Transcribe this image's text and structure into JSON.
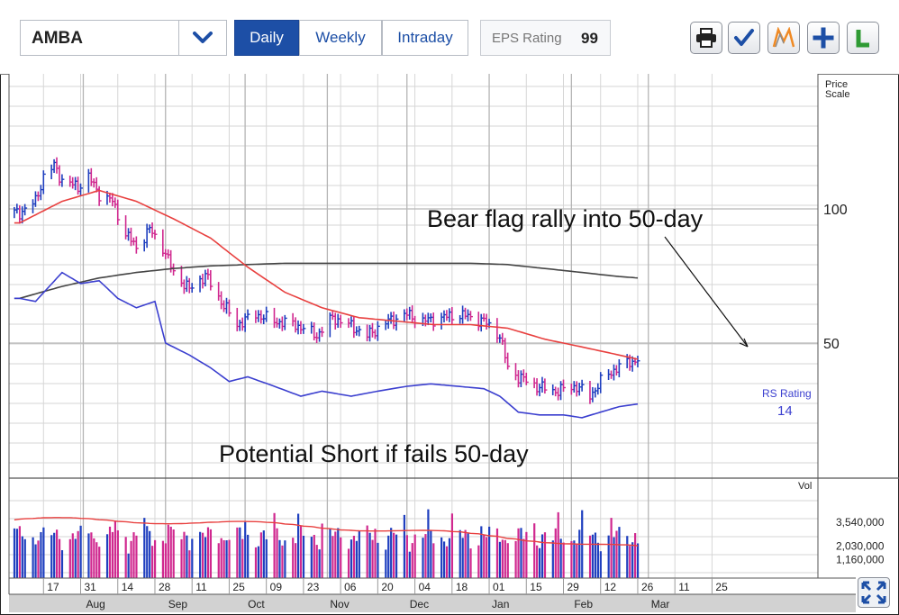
{
  "toolbar": {
    "symbol": "AMBA",
    "tabs": [
      {
        "label": "Daily",
        "active": true
      },
      {
        "label": "Weekly",
        "active": false
      },
      {
        "label": "Intraday",
        "active": false
      }
    ],
    "eps_label": "EPS Rating",
    "eps_value": "99",
    "tools": [
      "print-icon",
      "checkmark-icon",
      "marketsmith-logo-icon",
      "plus-icon",
      "leaderboard-l-icon"
    ]
  },
  "colors": {
    "up_bar": "#1f3fbf",
    "down_bar": "#d0288f",
    "ma50": "#e8403f",
    "ma200": "#444444",
    "rs_line": "#3b3fcf",
    "vol_avg": "#e8403f",
    "grid": "#d6d6d6",
    "panel_border": "#555555",
    "brand_blue": "#1d4fa6"
  },
  "chart_data": {
    "type": "bar",
    "title": "",
    "price_scale_label": "Price Scale",
    "price_ticks": [
      100,
      50
    ],
    "price_ticks_labels": [
      "100",
      "50"
    ],
    "y_scale": "log",
    "volume_label": "Vol",
    "volume_ticks": [
      3540000,
      2030000,
      1160000
    ],
    "volume_ticks_labels": [
      "3,540,000",
      "2,030,000",
      "1,160,000"
    ],
    "volume_ylim": [
      0,
      6000000
    ],
    "x_ticks": [
      {
        "date": "2015-07-17",
        "label": "17"
      },
      {
        "date": "2015-07-31",
        "label": "31"
      },
      {
        "date": "2015-08-14",
        "label": "14"
      },
      {
        "date": "2015-08-28",
        "label": "28"
      },
      {
        "date": "2015-09-11",
        "label": "11"
      },
      {
        "date": "2015-09-25",
        "label": "25"
      },
      {
        "date": "2015-10-09",
        "label": "09"
      },
      {
        "date": "2015-10-23",
        "label": "23"
      },
      {
        "date": "2015-11-06",
        "label": "06"
      },
      {
        "date": "2015-11-20",
        "label": "20"
      },
      {
        "date": "2015-12-04",
        "label": "04"
      },
      {
        "date": "2015-12-18",
        "label": "18"
      },
      {
        "date": "2016-01-01",
        "label": "01"
      },
      {
        "date": "2016-01-15",
        "label": "15"
      },
      {
        "date": "2016-01-29",
        "label": "29"
      },
      {
        "date": "2016-02-12",
        "label": "12"
      },
      {
        "date": "2016-02-26",
        "label": "26"
      },
      {
        "date": "2016-03-11",
        "label": "11"
      },
      {
        "date": "2016-03-25",
        "label": "25"
      }
    ],
    "month_labels": [
      {
        "date": "2015-08-01",
        "label": "Aug"
      },
      {
        "date": "2015-09-01",
        "label": "Sep"
      },
      {
        "date": "2015-10-01",
        "label": "Oct"
      },
      {
        "date": "2015-11-01",
        "label": "Nov"
      },
      {
        "date": "2015-12-01",
        "label": "Dec"
      },
      {
        "date": "2016-01-01",
        "label": "Jan"
      },
      {
        "date": "2016-02-01",
        "label": "Feb"
      },
      {
        "date": "2016-03-01",
        "label": "Mar"
      }
    ],
    "price_anchors": [
      [
        "2015-07-08",
        98
      ],
      [
        "2015-07-14",
        104
      ],
      [
        "2015-07-17",
        118
      ],
      [
        "2015-07-21",
        125
      ],
      [
        "2015-07-24",
        116
      ],
      [
        "2015-07-30",
        112
      ],
      [
        "2015-08-03",
        118
      ],
      [
        "2015-08-07",
        108
      ],
      [
        "2015-08-12",
        104
      ],
      [
        "2015-08-17",
        88
      ],
      [
        "2015-08-21",
        82
      ],
      [
        "2015-08-26",
        90
      ],
      [
        "2015-08-31",
        82
      ],
      [
        "2015-09-04",
        72
      ],
      [
        "2015-09-10",
        66
      ],
      [
        "2015-09-16",
        71
      ],
      [
        "2015-09-22",
        62
      ],
      [
        "2015-09-28",
        55
      ],
      [
        "2015-10-05",
        58
      ],
      [
        "2015-10-12",
        56
      ],
      [
        "2015-10-20",
        55
      ],
      [
        "2015-10-28",
        52
      ],
      [
        "2015-11-03",
        57
      ],
      [
        "2015-11-09",
        55
      ],
      [
        "2015-11-16",
        52
      ],
      [
        "2015-11-24",
        56
      ],
      [
        "2015-12-01",
        58
      ],
      [
        "2015-12-07",
        56
      ],
      [
        "2015-12-14",
        57
      ],
      [
        "2015-12-21",
        58
      ],
      [
        "2015-12-30",
        56
      ],
      [
        "2016-01-05",
        52
      ],
      [
        "2016-01-08",
        44
      ],
      [
        "2016-01-12",
        42
      ],
      [
        "2016-01-19",
        40
      ],
      [
        "2016-01-26",
        39
      ],
      [
        "2016-02-03",
        40
      ],
      [
        "2016-02-08",
        38
      ],
      [
        "2016-02-12",
        41
      ],
      [
        "2016-02-18",
        44
      ],
      [
        "2016-02-26",
        46
      ]
    ],
    "ma50_anchors": [
      [
        "2015-07-08",
        93
      ],
      [
        "2015-07-24",
        104
      ],
      [
        "2015-08-07",
        110
      ],
      [
        "2015-08-21",
        104
      ],
      [
        "2015-09-04",
        95
      ],
      [
        "2015-09-18",
        86
      ],
      [
        "2015-10-02",
        74
      ],
      [
        "2015-10-16",
        65
      ],
      [
        "2015-10-30",
        60
      ],
      [
        "2015-11-13",
        57
      ],
      [
        "2015-11-27",
        56
      ],
      [
        "2015-12-11",
        55
      ],
      [
        "2015-12-25",
        55
      ],
      [
        "2016-01-08",
        54
      ],
      [
        "2016-01-22",
        51
      ],
      [
        "2016-02-05",
        49
      ],
      [
        "2016-02-19",
        47
      ],
      [
        "2016-02-26",
        46
      ]
    ],
    "ma200_anchors": [
      [
        "2015-07-08",
        63
      ],
      [
        "2015-07-24",
        67
      ],
      [
        "2015-08-07",
        70
      ],
      [
        "2015-08-21",
        72
      ],
      [
        "2015-09-04",
        73.5
      ],
      [
        "2015-09-18",
        74.5
      ],
      [
        "2015-10-02",
        75
      ],
      [
        "2015-10-16",
        75.5
      ],
      [
        "2015-10-30",
        75.5
      ],
      [
        "2015-11-13",
        75.5
      ],
      [
        "2015-11-27",
        75.5
      ],
      [
        "2015-12-11",
        75.5
      ],
      [
        "2015-12-25",
        75.5
      ],
      [
        "2016-01-08",
        75
      ],
      [
        "2016-01-22",
        73.5
      ],
      [
        "2016-02-05",
        72
      ],
      [
        "2016-02-19",
        70.5
      ],
      [
        "2016-02-26",
        70
      ]
    ],
    "rs_line_anchors": [
      [
        "2015-07-08",
        63
      ],
      [
        "2015-07-14",
        62
      ],
      [
        "2015-07-24",
        72
      ],
      [
        "2015-07-31",
        68
      ],
      [
        "2015-08-07",
        69
      ],
      [
        "2015-08-14",
        63
      ],
      [
        "2015-08-21",
        60
      ],
      [
        "2015-08-28",
        62
      ],
      [
        "2015-09-01",
        50
      ],
      [
        "2015-09-10",
        47
      ],
      [
        "2015-09-18",
        44
      ],
      [
        "2015-09-25",
        41
      ],
      [
        "2015-10-02",
        42
      ],
      [
        "2015-10-12",
        40
      ],
      [
        "2015-10-22",
        38
      ],
      [
        "2015-10-30",
        39
      ],
      [
        "2015-11-10",
        38
      ],
      [
        "2015-11-20",
        39
      ],
      [
        "2015-12-01",
        40
      ],
      [
        "2015-12-10",
        40.5
      ],
      [
        "2015-12-20",
        40
      ],
      [
        "2015-12-30",
        39.5
      ],
      [
        "2016-01-05",
        38
      ],
      [
        "2016-01-12",
        35
      ],
      [
        "2016-01-20",
        34.5
      ],
      [
        "2016-01-29",
        34.5
      ],
      [
        "2016-02-05",
        34
      ],
      [
        "2016-02-12",
        35
      ],
      [
        "2016-02-19",
        36
      ],
      [
        "2016-02-26",
        36.5
      ]
    ],
    "series": [
      {
        "name": "RS Rating",
        "rating": "14"
      }
    ],
    "annotations": [
      "Bear flag rally into 50-day",
      "Potential Short if fails 50-day"
    ]
  }
}
